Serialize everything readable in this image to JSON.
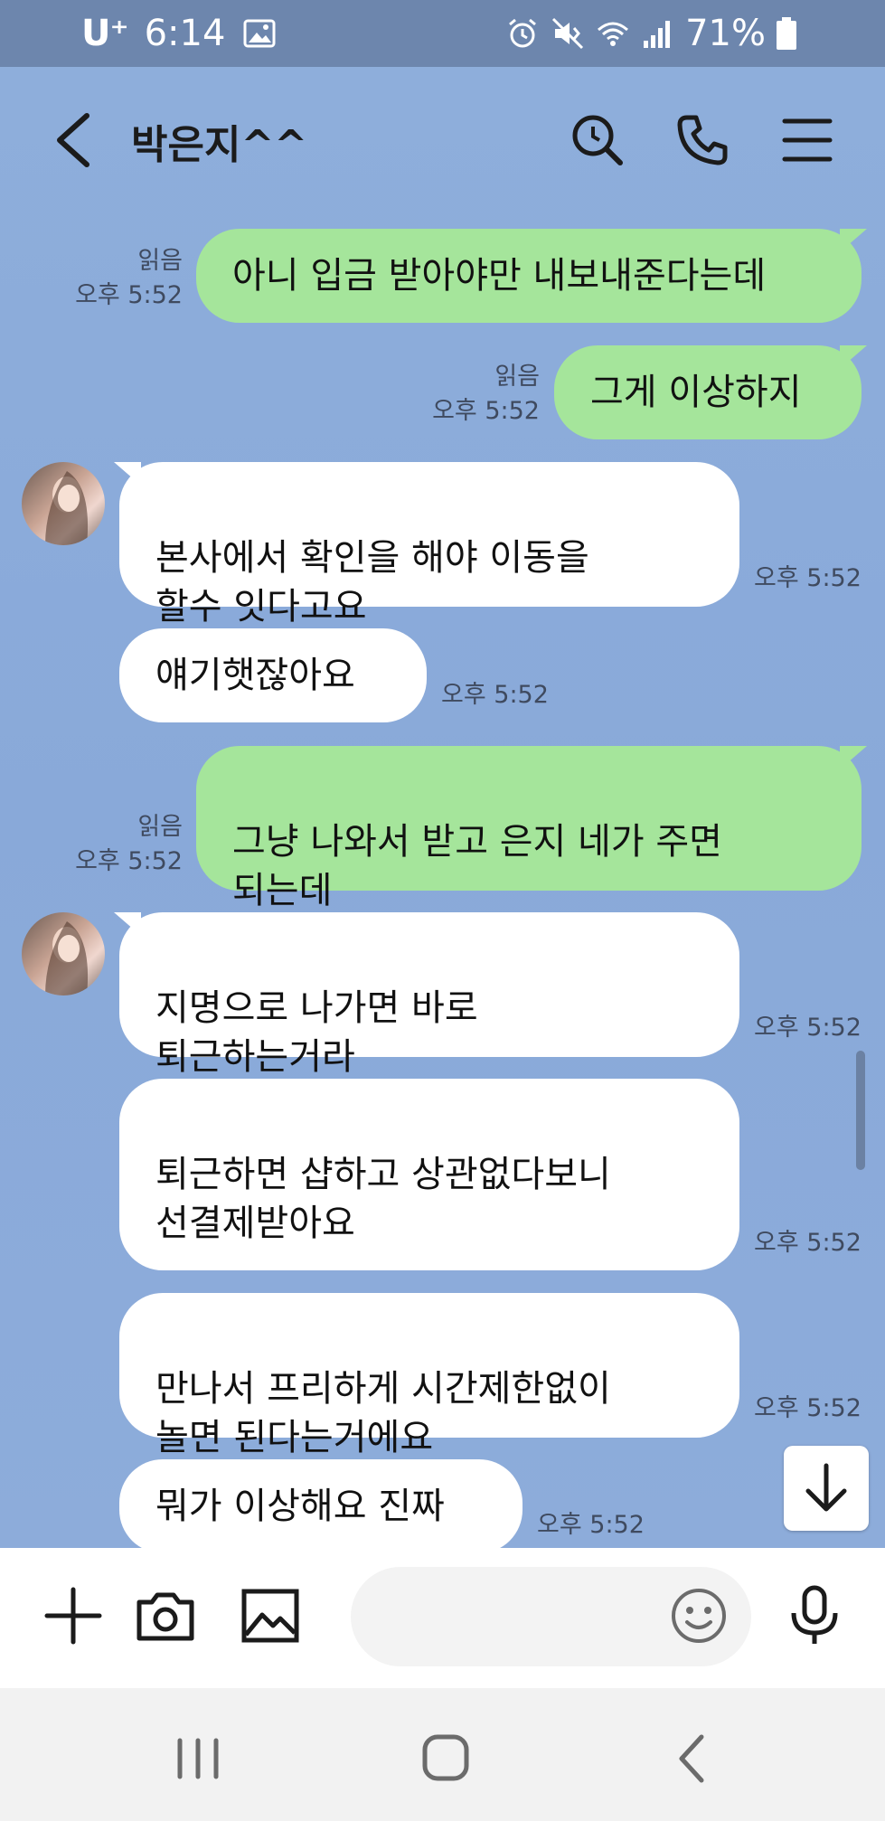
{
  "status_bar": {
    "carrier": "U⁺",
    "time": "6:14",
    "battery": "71%"
  },
  "header": {
    "title": "박은지^^",
    "icons": [
      "back-icon",
      "search-icon",
      "phone-icon",
      "menu-icon"
    ]
  },
  "messages": [
    {
      "from": "me",
      "text": "아니 입금 받아야만 내보내준다는데",
      "read": "읽음",
      "time": "오후 5:52"
    },
    {
      "from": "me",
      "text": "그게 이상하지",
      "read": "읽음",
      "time": "오후 5:52"
    },
    {
      "from": "other",
      "text": "본사에서 확인을 해야 이동을\n할수 잇다고요",
      "time": "오후 5:52"
    },
    {
      "from": "other",
      "text": "얘기햇잖아요",
      "time": "오후 5:52"
    },
    {
      "from": "me",
      "text": "그냥 나와서 받고 은지 네가 주면\n되는데",
      "read": "읽음",
      "time": "오후 5:52"
    },
    {
      "from": "other",
      "text": "지명으로 나가면 바로\n퇴근하는거라",
      "time": "오후 5:52"
    },
    {
      "from": "other",
      "text": "퇴근하면 샵하고 상관없다보니\n선결제받아요",
      "time": "오후 5:52"
    },
    {
      "from": "other",
      "text": "만나서 프리하게 시간제한없이\n놀면 된다는거에요",
      "time": "오후 5:52"
    },
    {
      "from": "other",
      "text": "뭐가 이상해요 진짜",
      "time": "오후 5:52"
    }
  ],
  "input_bar": {
    "placeholder": "",
    "icons": [
      "plus-icon",
      "camera-icon",
      "image-icon",
      "emoji-icon",
      "mic-icon"
    ]
  },
  "colors": {
    "chat_background": "#8eaedb",
    "my_bubble": "#a5e59b",
    "other_bubble": "#ffffff",
    "status_bar": "#6d86ad"
  }
}
